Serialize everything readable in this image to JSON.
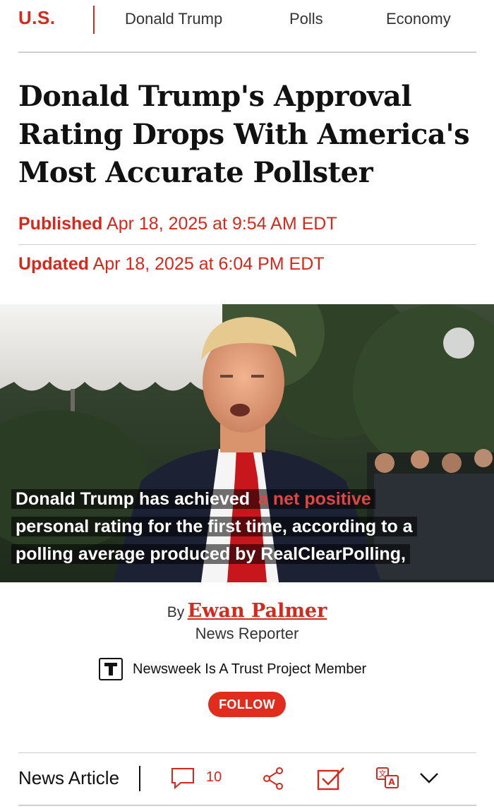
{
  "nav": {
    "section": "U.S.",
    "links": [
      "Donald Trump",
      "Polls",
      "Economy"
    ]
  },
  "article": {
    "headline_lines": [
      "Donald Trump's Approval",
      "Rating Drops With America's",
      "Most Accurate Pollster"
    ],
    "published_label": "Published",
    "published_date": "Apr 18, 2025 at 9:54 AM EDT",
    "updated_label": "Updated",
    "updated_date": "Apr 18, 2025 at 6:04 PM EDT"
  },
  "hero": {
    "caption_line1_a": "Donald Trump has achieved",
    "caption_line1_highlight": "a net positive",
    "caption_line2": "personal rating for the first time, according to a",
    "caption_line3": "polling average produced by RealClearPolling,"
  },
  "byline": {
    "by_label": "By",
    "author": "Ewan Palmer",
    "role": "News Reporter",
    "trust_text": "Newsweek Is A Trust Project Member",
    "follow_label": "FOLLOW"
  },
  "toolbar": {
    "article_type": "News Article",
    "comment_count": "10",
    "icons": [
      "comment-icon",
      "share-icon",
      "checkbox-icon",
      "translate-icon",
      "chevron-down-icon"
    ]
  },
  "colors": {
    "accent": "#d4291c",
    "follow_bg": "#e02d1d",
    "divider": "#cfcfcf"
  }
}
